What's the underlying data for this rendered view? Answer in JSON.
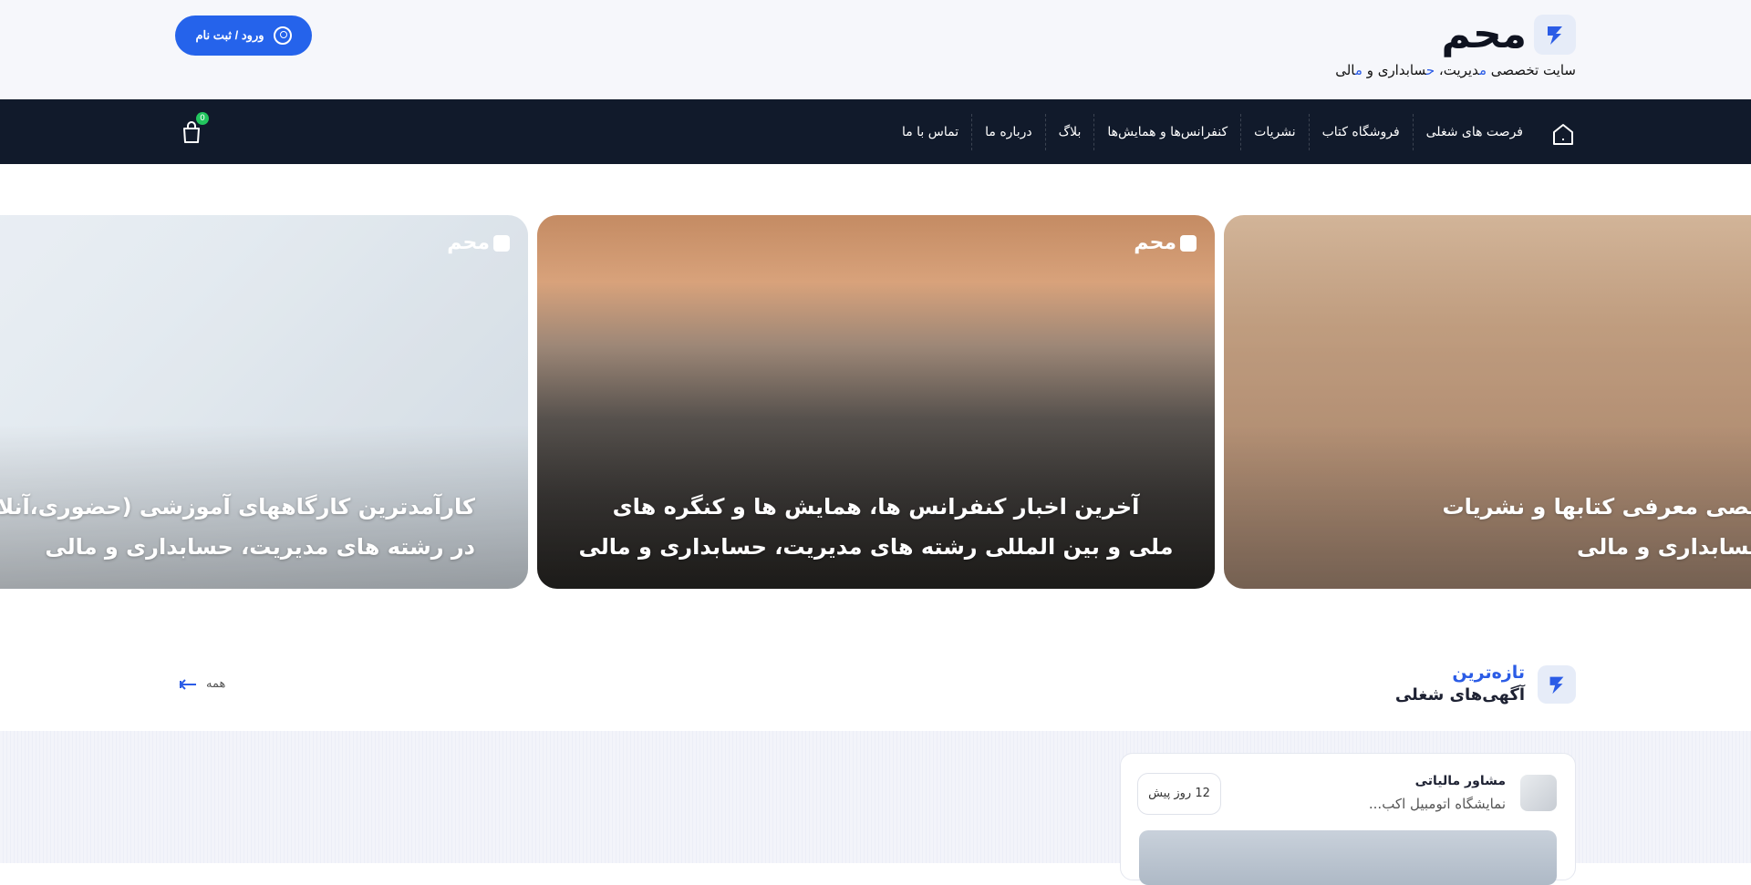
{
  "header": {
    "logo_text": "محم",
    "tagline_parts": [
      "سایت تخصصی ",
      "م",
      "دیریت، ",
      "ح",
      "سابداری و ",
      "م",
      "الی"
    ],
    "login_label": "ورود / ثبت نام"
  },
  "nav": {
    "items": [
      "فرصت های شغلی",
      "فروشگاه کتاب",
      "نشریات",
      "کنفرانس‌ها و همایش‌ها",
      "بلاگ",
      "درباره ما",
      "تماس با ما"
    ],
    "cart_count": "0"
  },
  "slides": [
    {
      "logo": "محم",
      "line1": "کارآمدترین کارگاههای آموزشی (حضوری،آنلاین و آفلاین)",
      "line2": "در رشته های مدیریت، حسابداری و مالی"
    },
    {
      "logo": "محم",
      "line1": "آخرین اخبار کنفرانس ها، همایش ها و کنگره های",
      "line2": "ملی و بین المللی رشته های مدیریت، حسابداری و مالی"
    },
    {
      "logo": "",
      "line1": "مرجع تخصصی معرفی کتابها و نشریات",
      "line2": "مدیریت، حسابداری و مالی"
    }
  ],
  "section": {
    "title_accent": "تازه‌ترین",
    "title_main": "آگهی‌های شغلی",
    "see_all": "همه"
  },
  "jobs": [
    {
      "title": "مشاور مالیاتی",
      "company": "نمایشگاه اتومبیل اکب...",
      "time": "12 روز پیش"
    }
  ],
  "colors": {
    "accent": "#2563eb",
    "navbar": "#111a2b",
    "badge": "#22c55e"
  }
}
